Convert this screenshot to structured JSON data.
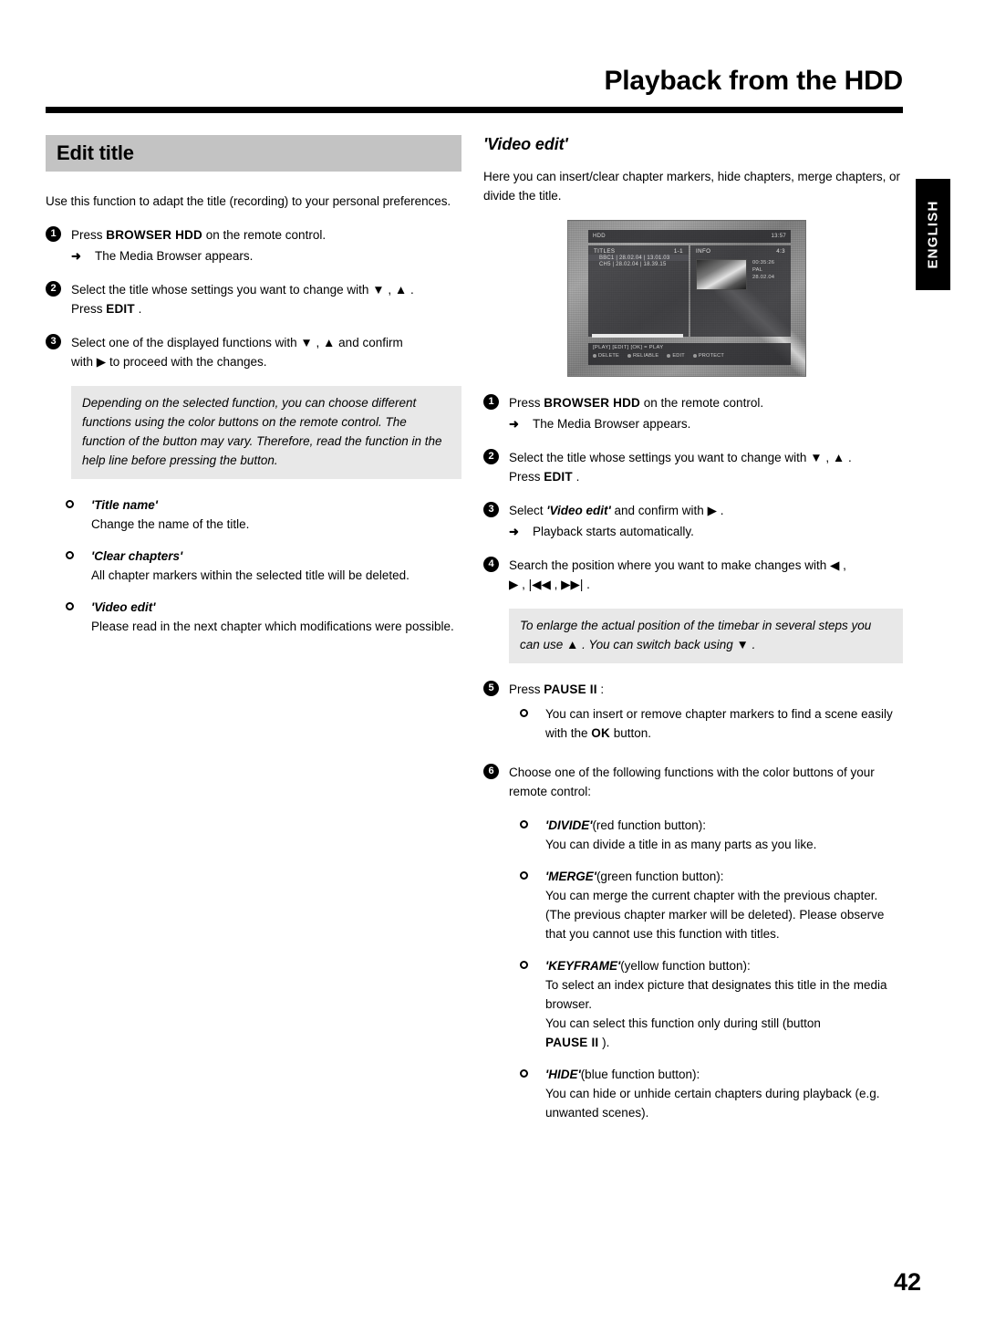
{
  "header": {
    "title": "Playback from the HDD"
  },
  "language_tab": {
    "label": "ENGLISH"
  },
  "left_column": {
    "section_title": "Edit title",
    "intro": "Use this function to adapt the title (recording) to your personal preferences.",
    "steps": [
      {
        "num": "1",
        "text_before": "Press",
        "kbd": "BROWSER HDD",
        "text_after": "on the remote control.",
        "result": "The Media Browser appears."
      },
      {
        "num": "2",
        "line1_before": "Select the title whose settings you want to change with",
        "arrows": "▼ , ▲ .",
        "line2_before": "Press",
        "kbd": "EDIT",
        "line2_after": "."
      },
      {
        "num": "3",
        "line1_before": "Select one of the displayed functions with",
        "arrows": "▼ , ▲",
        "line1_after": "and confirm",
        "line2_before": "with",
        "arrow2": "▶",
        "line2_after": "to proceed with the changes."
      }
    ],
    "note": "Depending on the selected function, you can choose different functions using the color buttons on the remote control. The function of the button may vary. Therefore, read the function in the help line before pressing the button.",
    "bullets": [
      {
        "title": "'Title name'",
        "body": "Change the name of the title."
      },
      {
        "title": "'Clear chapters'",
        "body": "All chapter markers within the selected title will be deleted."
      },
      {
        "title": "'Video edit'",
        "body": "Please read in the next chapter which modifications were possible."
      }
    ]
  },
  "right_column": {
    "heading": "'Video edit'",
    "intro": "Here you can insert/clear chapter markers, hide chapters, merge chapters, or divide the title.",
    "tv_screenshot": {
      "topbar_left": "HDD",
      "topbar_right": "13:57",
      "left_panel_header": "TITLES",
      "left_panel_count": "1-1",
      "rows": [
        "BBC1 | 28.02.04 | 13.01.03",
        "CH5 | 28.02.04 | 18.39.15"
      ],
      "right_panel_header": "INFO",
      "right_panel_badge": "4:3",
      "meta_lines": [
        "00:35:26",
        "PAL",
        "28.02.04"
      ],
      "help_line": "[PLAY] [EDIT] [OK] = PLAY",
      "color_buttons": [
        "DELETE",
        "RELIABLE",
        "EDIT",
        "PROTECT"
      ]
    },
    "steps": [
      {
        "num": "1",
        "text_before": "Press",
        "kbd": "BROWSER HDD",
        "text_after": "on the remote control.",
        "result": "The Media Browser appears."
      },
      {
        "num": "2",
        "line1_before": "Select the title whose settings you want to change with",
        "arrows": "▼ , ▲ .",
        "line2_before": "Press",
        "kbd": "EDIT",
        "line2_after": "."
      },
      {
        "num": "3",
        "line1_before": "Select",
        "ital": "'Video edit'",
        "line1_mid": "and confirm with",
        "arrow": "▶",
        "line1_after": ".",
        "result": "Playback starts automatically."
      },
      {
        "num": "4",
        "line1_before": "Search the position where you want to make changes with",
        "arrows1": "◀ ,",
        "arrows2": "▶ , |◀◀ , ▶▶| ."
      }
    ],
    "note": "To enlarge the actual position of the timebar in several steps you can use ▲ . You can switch back using ▼ .",
    "step5": {
      "num": "5",
      "text_before": "Press",
      "kbd": "PAUSE II",
      "text_after": ":",
      "bullet_before": "You can insert or remove chapter markers to find a scene easily with the",
      "bullet_kbd": "OK",
      "bullet_after": "button."
    },
    "step6": {
      "num": "6",
      "text": "Choose one of the following functions with the color buttons of your remote control:"
    },
    "function_bullets": [
      {
        "name": "'DIVIDE'",
        "suffix": "(red function button):",
        "body": "You can divide a title in as many parts as you like."
      },
      {
        "name": "'MERGE'",
        "suffix": "(green function button):",
        "body": "You can merge the current chapter with the previous chapter. (The previous chapter marker will be deleted). Please observe that you cannot use this function with titles."
      },
      {
        "name": "'KEYFRAME'",
        "suffix": "(yellow function button):",
        "body": "To select an index picture that designates this title in the media browser.",
        "body2_before": "You can select this function only during still (button",
        "body2_kbd": "PAUSE II",
        "body2_after": ")."
      },
      {
        "name": "'HIDE'",
        "suffix": "(blue function button):",
        "body": "You can hide or unhide certain chapters during playback (e.g. unwanted scenes)."
      }
    ]
  },
  "footer": {
    "page_number": "42"
  }
}
